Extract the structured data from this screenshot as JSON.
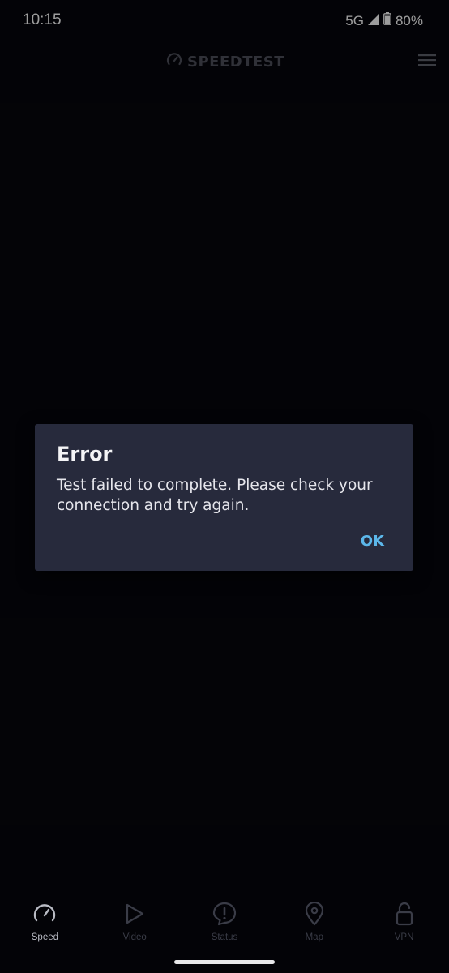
{
  "status_bar": {
    "time": "10:15",
    "network": "5G",
    "battery": "80%"
  },
  "header": {
    "app_name": "SPEEDTEST"
  },
  "dialog": {
    "title": "Error",
    "message": "Test failed to complete. Please check your connection and try again.",
    "ok_label": "OK"
  },
  "bottom_nav": {
    "items": [
      {
        "label": "Speed",
        "icon": "speedometer-icon",
        "active": true
      },
      {
        "label": "Video",
        "icon": "play-icon",
        "active": false
      },
      {
        "label": "Status",
        "icon": "alert-icon",
        "active": false
      },
      {
        "label": "Map",
        "icon": "map-pin-icon",
        "active": false
      },
      {
        "label": "VPN",
        "icon": "unlock-icon",
        "active": false
      }
    ]
  },
  "colors": {
    "background": "#06060b",
    "dialog_bg": "#272a3c",
    "accent": "#5cb7ea",
    "inactive": "#3a3c47"
  }
}
